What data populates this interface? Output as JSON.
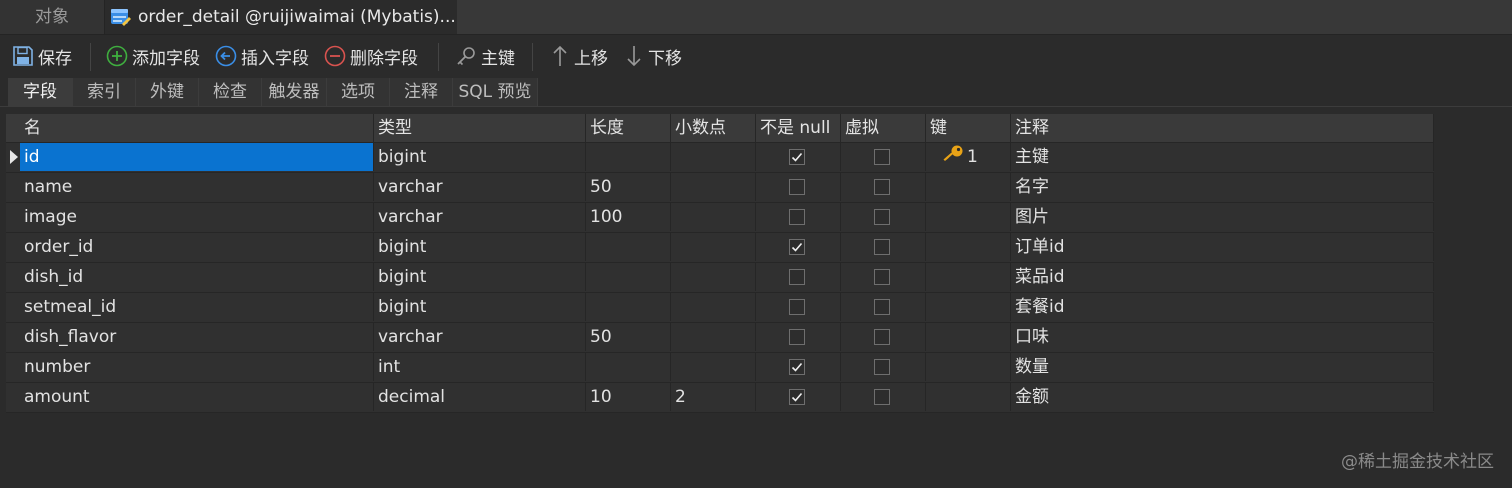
{
  "tabs": {
    "objects_label": "对象",
    "active_title": "order_detail @ruijiwaimai (Mybatis)..."
  },
  "toolbar": {
    "save": "保存",
    "add_field": "添加字段",
    "insert_field": "插入字段",
    "delete_field": "删除字段",
    "primary_key": "主键",
    "move_up": "上移",
    "move_down": "下移"
  },
  "subtabs": [
    "字段",
    "索引",
    "外键",
    "检查",
    "触发器",
    "选项",
    "注释",
    "SQL 预览"
  ],
  "grid": {
    "columns": [
      "名",
      "类型",
      "长度",
      "小数点",
      "不是 null",
      "虚拟",
      "键",
      "注释"
    ],
    "rows": [
      {
        "name": "id",
        "type": "bigint",
        "length": "",
        "decimals": "",
        "not_null": true,
        "virtual": false,
        "key": "1",
        "comment": "主键"
      },
      {
        "name": "name",
        "type": "varchar",
        "length": "50",
        "decimals": "",
        "not_null": false,
        "virtual": false,
        "key": "",
        "comment": "名字"
      },
      {
        "name": "image",
        "type": "varchar",
        "length": "100",
        "decimals": "",
        "not_null": false,
        "virtual": false,
        "key": "",
        "comment": "图片"
      },
      {
        "name": "order_id",
        "type": "bigint",
        "length": "",
        "decimals": "",
        "not_null": true,
        "virtual": false,
        "key": "",
        "comment": "订单id"
      },
      {
        "name": "dish_id",
        "type": "bigint",
        "length": "",
        "decimals": "",
        "not_null": false,
        "virtual": false,
        "key": "",
        "comment": "菜品id"
      },
      {
        "name": "setmeal_id",
        "type": "bigint",
        "length": "",
        "decimals": "",
        "not_null": false,
        "virtual": false,
        "key": "",
        "comment": "套餐id"
      },
      {
        "name": "dish_flavor",
        "type": "varchar",
        "length": "50",
        "decimals": "",
        "not_null": false,
        "virtual": false,
        "key": "",
        "comment": "口味"
      },
      {
        "name": "number",
        "type": "int",
        "length": "",
        "decimals": "",
        "not_null": true,
        "virtual": false,
        "key": "",
        "comment": "数量"
      },
      {
        "name": "amount",
        "type": "decimal",
        "length": "10",
        "decimals": "2",
        "not_null": true,
        "virtual": false,
        "key": "",
        "comment": "金额"
      }
    ]
  },
  "watermark": "@稀土掘金技术社区",
  "colors": {
    "background": "#2b2b2b",
    "selection": "#0a73d0",
    "key_icon": "#e8a317",
    "add_icon": "#3fae3f",
    "insert_icon": "#3a8ee6",
    "delete_icon": "#d9534f"
  }
}
